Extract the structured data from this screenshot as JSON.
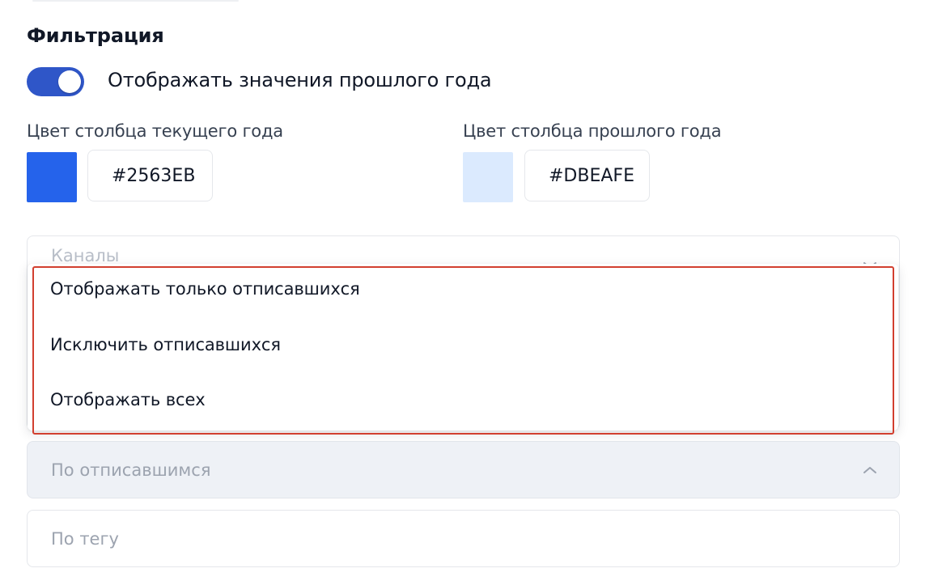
{
  "filter_section": {
    "title": "Фильтрация",
    "show_last_year_toggle": {
      "label": "Отображать значения прошлого года",
      "checked": true
    },
    "current_year_color": {
      "label": "Цвет столбца текущего года",
      "hex": "#2563EB",
      "display_value": "#2563EB"
    },
    "last_year_color": {
      "label": "Цвет столбца прошлого года",
      "hex": "#DBEAFE",
      "display_value": "#DBEAFE"
    },
    "channels_select": {
      "placeholder": "Каналы"
    },
    "unsubscribed_dropdown": {
      "options": [
        "Отображать только отписавшихся",
        "Исключить отписавшихся",
        "Отображать всех"
      ]
    },
    "unsubscribed_select": {
      "placeholder": "По отписавшимся",
      "expanded": true
    },
    "tag_select": {
      "placeholder": "По тегу"
    }
  },
  "colors": {
    "toggle_on": "#2F56C8",
    "highlight_border": "#D23F2F"
  },
  "icons": {
    "channels_chevron": "chevron-down-icon",
    "unsubscribed_chevron": "chevron-up-icon"
  }
}
